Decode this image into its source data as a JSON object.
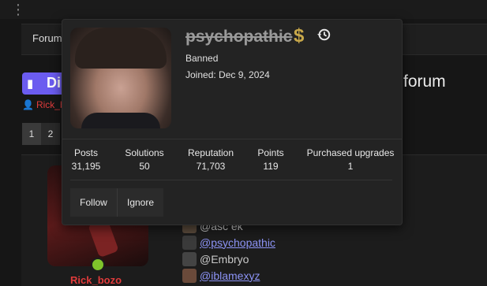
{
  "header": {
    "dots": "⋮"
  },
  "nav": {
    "forums_label": "Forum"
  },
  "thread": {
    "badge_label": "Di",
    "title_tail": "forum",
    "author": "Rick_b"
  },
  "pager": {
    "pages": [
      "1",
      "2"
    ]
  },
  "post": {
    "username": "Rick_bozo",
    "mentions": [
      {
        "text": "@asc  ek",
        "linked": false
      },
      {
        "text": "@psychopathic",
        "linked": true
      },
      {
        "text": "@Embryo",
        "linked": false
      },
      {
        "text": "@iblamexyz",
        "linked": true
      }
    ]
  },
  "card": {
    "username": "psychopathic",
    "dollar_glyph": "$",
    "status": "Banned",
    "joined": "Joined: Dec 9, 2024",
    "stats": [
      {
        "label": "Posts",
        "value": "31,195"
      },
      {
        "label": "Solutions",
        "value": "50"
      },
      {
        "label": "Reputation",
        "value": "71,703"
      },
      {
        "label": "Points",
        "value": "119"
      },
      {
        "label": "Purchased upgrades",
        "value": "1"
      }
    ],
    "follow_label": "Follow",
    "ignore_label": "Ignore"
  },
  "colors": {
    "accent": "#6b5cf0",
    "username_red": "#e03b3b",
    "link": "#8c93f5",
    "online": "#7fc42b",
    "gold": "#c8a84a"
  },
  "icons": [
    "user-icon",
    "dollar-icon",
    "history-icon",
    "comments-icon"
  ]
}
